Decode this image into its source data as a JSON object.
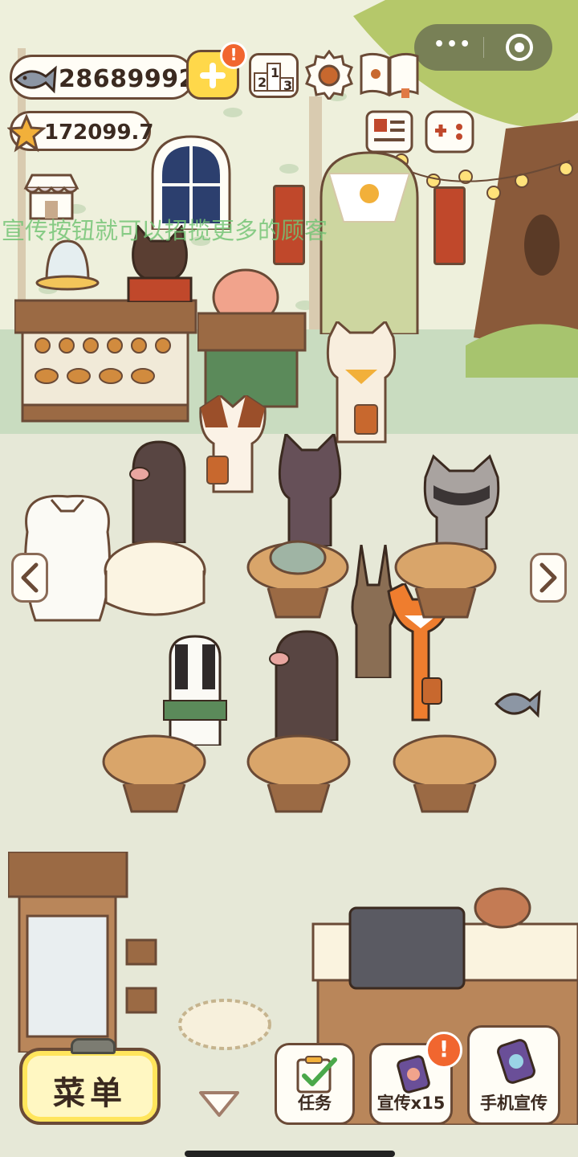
{
  "hud": {
    "fish_count": "28689992",
    "star_count": "172099.7",
    "add_alert": "!"
  },
  "top_icons": [
    "add-currency-icon",
    "leaderboard-icon",
    "settings-gear-icon",
    "cat-book-icon",
    "newspaper-icon",
    "game-controller-icon",
    "shop-icon"
  ],
  "leaderboard_digits": [
    "2",
    "1",
    "3"
  ],
  "capsule": {
    "dots": "•••"
  },
  "hint_text": "宣传按钮就可以招揽更多的顾客",
  "bottom": {
    "menu_label": "菜单",
    "task_label": "任务",
    "promo_label": "宣传x15",
    "promo_alert": "!",
    "phone_promo_label": "手机宣传"
  },
  "colors": {
    "outline": "#6a4a36",
    "accent_yellow": "#ffd84a",
    "alert_orange": "#f1662f",
    "hint_green": "#74c476"
  }
}
